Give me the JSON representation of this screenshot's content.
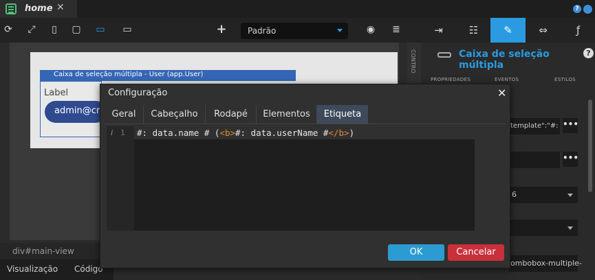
{
  "tabbar": {
    "tab_label": "home",
    "close_glyph": "✕",
    "help": "?"
  },
  "toolbar": {
    "device_value": "Padrão",
    "buttons": [
      "refresh-icon",
      "expand-icon",
      "phone-icon",
      "tablet-icon",
      "desktop-icon",
      "monitor-icon",
      "plus-icon",
      "eye-off-icon",
      "database-icon"
    ]
  },
  "right_panel": {
    "title": "Caixa de seleção múltipla",
    "tabs": [
      "import-icon",
      "tree-icon",
      "brush-icon",
      "swap-icon",
      "function-icon"
    ],
    "subtabs": [
      "PROPRIEDADES",
      "EVENTOS",
      "ESTILOS"
    ],
    "fields": [
      {
        "value": "template\":\"#:",
        "button": "•••"
      },
      {
        "value": "",
        "button": "•••"
      },
      {
        "value": "6"
      },
      {
        "value": ""
      },
      {
        "value": "ombobox-multiple-"
      }
    ]
  },
  "canvas": {
    "component_bar": "Caixa de seleção múltipla - User (app.User)",
    "label": "Label",
    "chip": "admin@cr",
    "rail": "CONTRO"
  },
  "bottom": {
    "breadcrumb": "div#main-view",
    "tabs": [
      "Visualização",
      "Código"
    ]
  },
  "dialog": {
    "title": "Configuração",
    "close": "✕",
    "tabs": [
      "Geral",
      "Cabeçalho",
      "Rodapé",
      "Elementos",
      "Etiqueta"
    ],
    "active_tab": "Etiqueta",
    "line_info": "i",
    "line_number": "1",
    "code": {
      "part1": "#: data.name # (",
      "tag_open": "<b>",
      "part2": "#: data.userName #",
      "tag_close": "</b>",
      "part3": ")"
    },
    "ok": "OK",
    "cancel": "Cancelar"
  },
  "colors": {
    "accent": "#2a9be0",
    "ok": "#2c9bd2",
    "cancel": "#c9303a",
    "tag": "#e08a32"
  }
}
